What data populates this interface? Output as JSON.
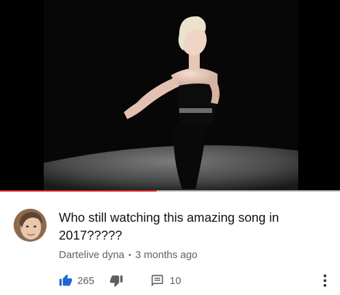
{
  "player": {
    "progress_fraction": 0.46,
    "progress_color": "#e52d27"
  },
  "comment": {
    "text": "Who still watching this amazing song in 2017?????",
    "author": "Dartelive dyna",
    "separator": "•",
    "time": "3 months ago",
    "like_count": "265",
    "reply_count": "10",
    "like_color": "#1e66d0"
  },
  "icons": {
    "like": "thumbs-up-icon",
    "dislike": "thumbs-down-icon",
    "reply": "comment-icon",
    "more": "more-vert-icon"
  }
}
